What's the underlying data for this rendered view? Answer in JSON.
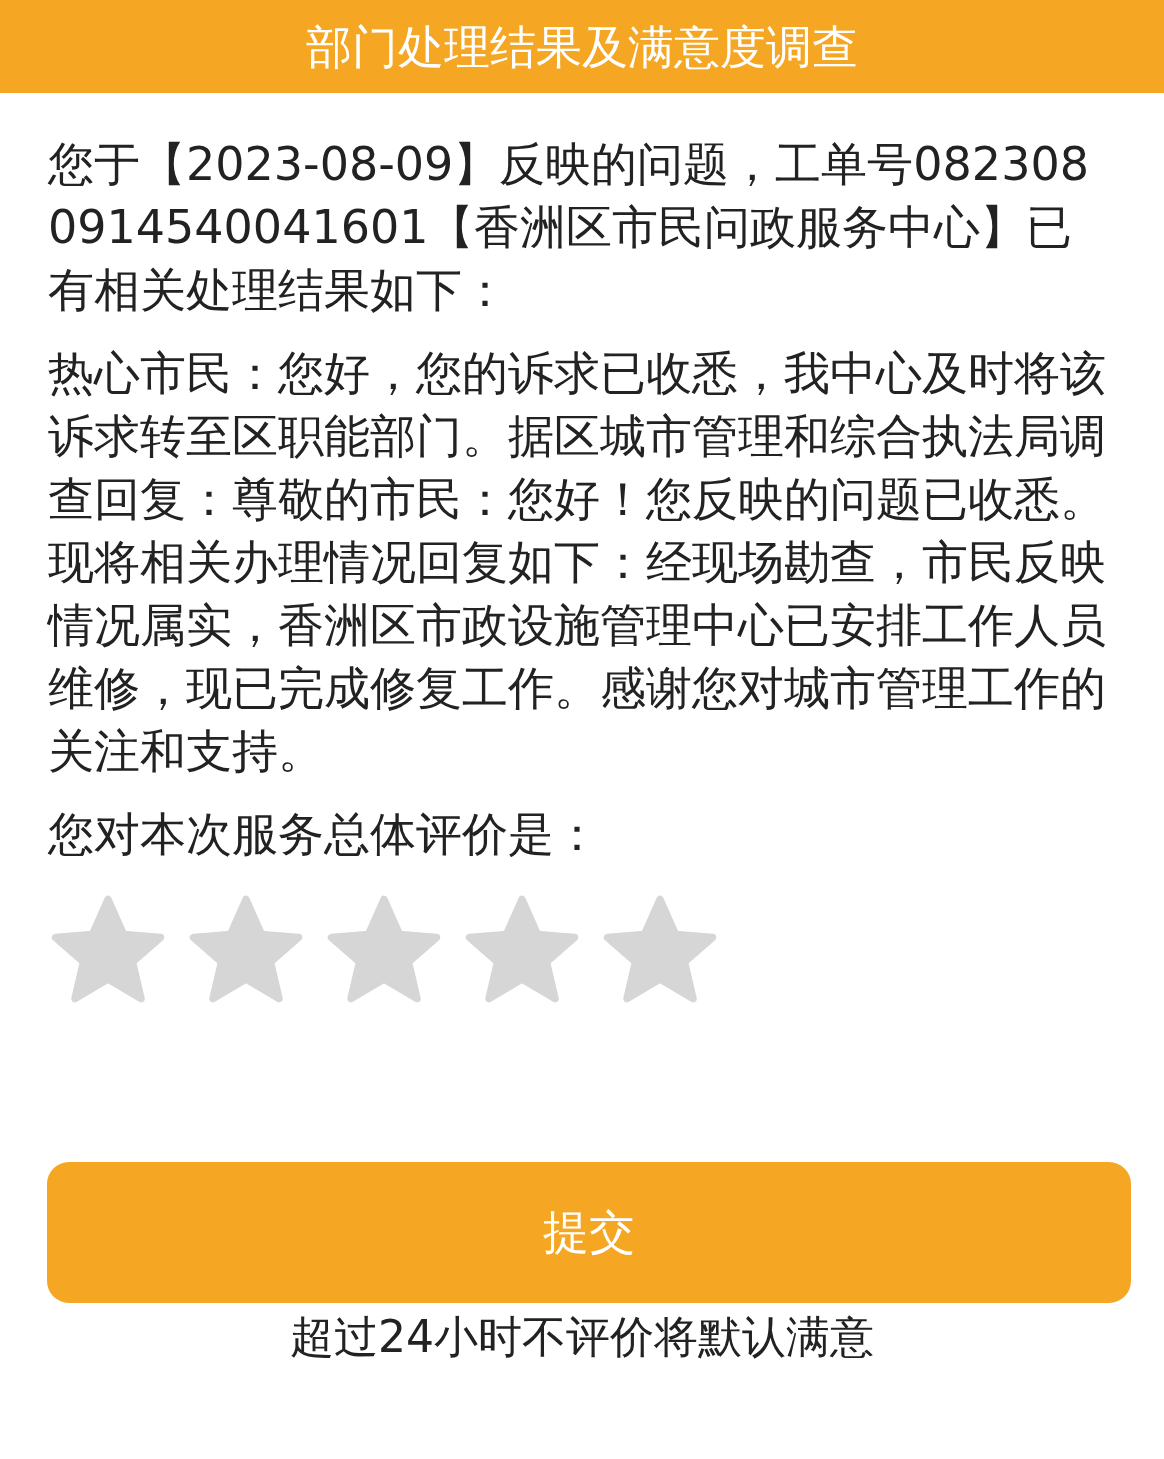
{
  "header": {
    "title": "部门处理结果及满意度调查"
  },
  "intro": "您于【2023-08-09】反映的问题，工单号0823080914540041601【香洲区市民问政服务中心】已有相关处理结果如下：",
  "reply": "热心市民：您好，您的诉求已收悉，我中心及时将该诉求转至区职能部门。据区城市管理和综合执法局调查回复：尊敬的市民：您好！您反映的问题已收悉。现将相关办理情况回复如下：经现场勘查，市民反映情况属实，香洲区市政设施管理中心已安排工作人员维修，现已完成修复工作。感谢您对城市管理工作的关注和支持。",
  "rating": {
    "label": "您对本次服务总体评价是：",
    "stars": 0
  },
  "submit_button": "提交",
  "note": "超过24小时不评价将默认满意"
}
